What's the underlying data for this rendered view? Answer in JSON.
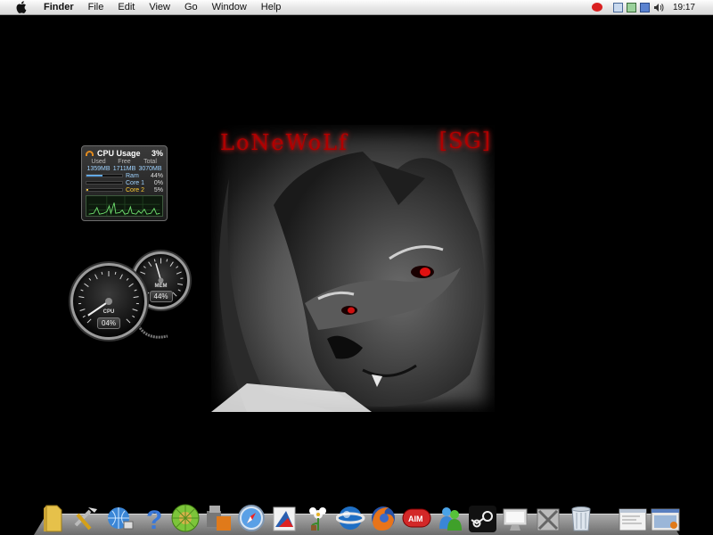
{
  "menubar": {
    "app_name": "Finder",
    "menus": [
      "File",
      "Edit",
      "View",
      "Go",
      "Window",
      "Help"
    ],
    "clock": "19:17"
  },
  "wallpaper": {
    "title": "LoNeWoLf",
    "tag": "[SG]"
  },
  "cpu_widget": {
    "title": "CPU Usage",
    "percent": "3%",
    "headers": [
      "Used",
      "Free",
      "Total"
    ],
    "values": [
      "1359MB",
      "1711MB",
      "3070MB"
    ],
    "bars": [
      {
        "label": "Ram",
        "pct": "44%",
        "fill": 0.44
      },
      {
        "label": "Core 1",
        "pct": "0%",
        "fill": 0.0
      },
      {
        "label": "Core 2",
        "pct": "5%",
        "fill": 0.05
      }
    ]
  },
  "gauges": {
    "cpu": {
      "label": "CPU",
      "value": "04%",
      "fraction": 0.04
    },
    "mem": {
      "label": "MEM",
      "value": "44%",
      "fraction": 0.44
    }
  },
  "dock": {
    "icons": [
      "folder-icon",
      "utilities-icon",
      "network-globe-icon",
      "help-icon",
      "melon-app-icon",
      "toolbox-app-icon",
      "safari-icon",
      "image-app-icon",
      "flower-app-icon",
      "browser-globe-icon",
      "firefox-icon",
      "aim-icon",
      "messenger-icon",
      "steam-icon",
      "monitor-icon",
      "system-tools-icon",
      "trash-icon",
      "window-1-icon",
      "window-2-icon"
    ],
    "aim_label": "AIM"
  }
}
